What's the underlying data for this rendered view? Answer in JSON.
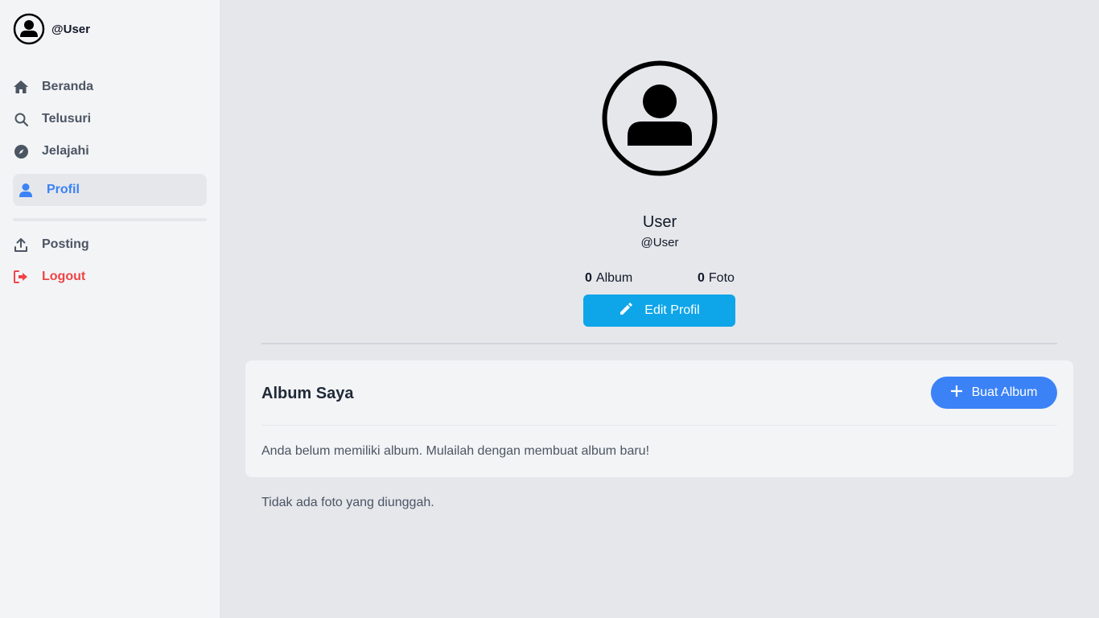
{
  "sidebar": {
    "handle": "@User",
    "nav": {
      "beranda": "Beranda",
      "telusuri": "Telusuri",
      "jelajahi": "Jelajahi",
      "profil": "Profil",
      "posting": "Posting",
      "logout": "Logout"
    },
    "icons": {
      "beranda": "home-icon",
      "telusuri": "search-icon",
      "jelajahi": "compass-icon",
      "profil": "user-icon",
      "posting": "upload-icon",
      "logout": "logout-icon"
    }
  },
  "profile": {
    "name": "User",
    "handle": "@User",
    "stats": {
      "album_count": "0",
      "album_label": "Album",
      "foto_count": "0",
      "foto_label": "Foto"
    },
    "edit_label": "Edit Profil"
  },
  "albums": {
    "title": "Album Saya",
    "create_label": "Buat Album",
    "empty_text": "Anda belum memiliki album. Mulailah dengan membuat album baru!"
  },
  "photos": {
    "empty_text": "Tidak ada foto yang diunggah."
  },
  "colors": {
    "accent": "#3b82f6",
    "edit_button": "#0ea5e9",
    "logout": "#ef4444"
  }
}
